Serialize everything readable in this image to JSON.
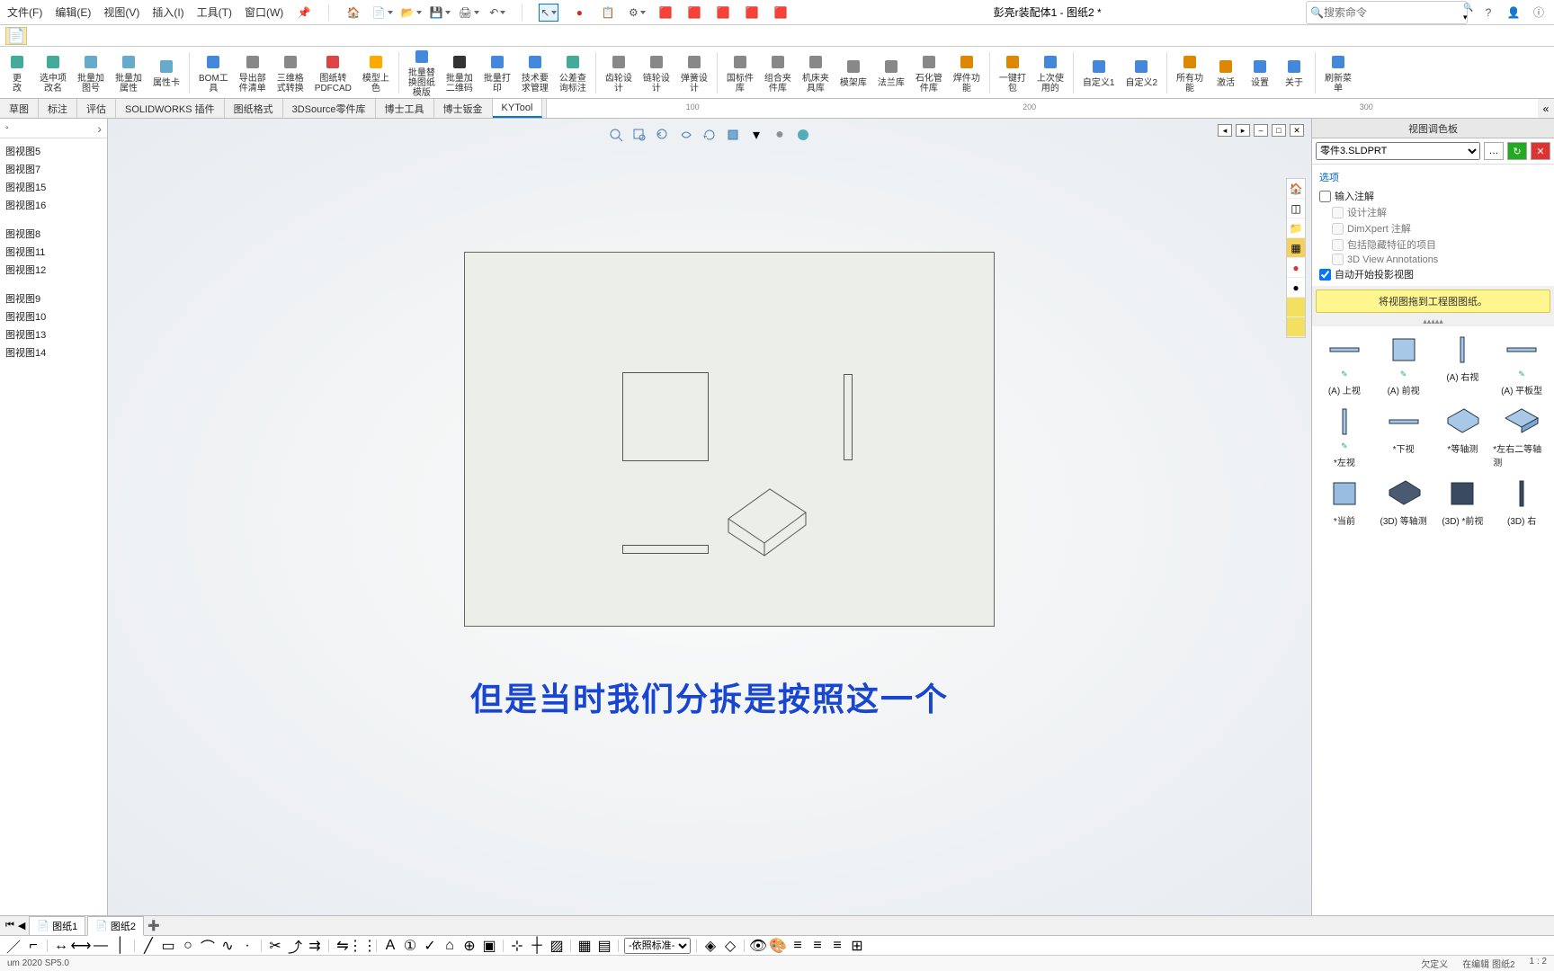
{
  "menubar": {
    "items": [
      {
        "label": "文件(F)"
      },
      {
        "label": "编辑(E)"
      },
      {
        "label": "视图(V)"
      },
      {
        "label": "插入(I)"
      },
      {
        "label": "工具(T)"
      },
      {
        "label": "窗口(W)"
      }
    ],
    "title": "彭亮r装配体1 - 图纸2 *",
    "search_placeholder": "搜索命令"
  },
  "ribbon": [
    {
      "label": "更\n改",
      "icon": "edit"
    },
    {
      "label": "选中项\n改名",
      "icon": "rename"
    },
    {
      "label": "批量加\n图号",
      "icon": "addnum"
    },
    {
      "label": "批量加\n属性",
      "icon": "addprop"
    },
    {
      "label": "属性卡",
      "icon": "card"
    },
    {
      "sep": true
    },
    {
      "label": "BOM工\n具",
      "icon": "bom"
    },
    {
      "label": "导出部\n件清单",
      "icon": "export"
    },
    {
      "label": "三维格\n式转换",
      "icon": "convert"
    },
    {
      "label": "图纸转\nPDFCAD",
      "icon": "pdf"
    },
    {
      "label": "模型上\n色",
      "icon": "color"
    },
    {
      "sep": true
    },
    {
      "label": "批量替\n换图纸\n模版",
      "icon": "replace"
    },
    {
      "label": "批量加\n二维码",
      "icon": "qr"
    },
    {
      "label": "批量打\n印",
      "icon": "print"
    },
    {
      "label": "技术要\n求管理",
      "icon": "tech"
    },
    {
      "label": "公差查\n询标注",
      "icon": "tol"
    },
    {
      "sep": true
    },
    {
      "label": "齿轮设\n计",
      "icon": "gear"
    },
    {
      "label": "链轮设\n计",
      "icon": "sprocket"
    },
    {
      "label": "弹簧设\n计",
      "icon": "spring"
    },
    {
      "sep": true
    },
    {
      "label": "国标件\n库",
      "icon": "gb"
    },
    {
      "label": "组合夹\n件库",
      "icon": "clamp"
    },
    {
      "label": "机床夹\n具库",
      "icon": "fixture"
    },
    {
      "label": "模架库",
      "icon": "mold"
    },
    {
      "label": "法兰库",
      "icon": "flange"
    },
    {
      "label": "石化管\n件库",
      "icon": "pipe"
    },
    {
      "label": "焊件功\n能",
      "icon": "weld"
    },
    {
      "sep": true
    },
    {
      "label": "一键打\n包",
      "icon": "pack"
    },
    {
      "label": "上次使\n用的",
      "icon": "recent"
    },
    {
      "sep": true
    },
    {
      "label": "自定义1",
      "icon": "u1"
    },
    {
      "label": "自定义2",
      "icon": "u2"
    },
    {
      "sep": true
    },
    {
      "label": "所有功\n能",
      "icon": "all"
    },
    {
      "label": "激活",
      "icon": "activate"
    },
    {
      "label": "设置",
      "icon": "setting"
    },
    {
      "label": "关于",
      "icon": "about"
    },
    {
      "sep": true
    },
    {
      "label": "刷新菜\n单",
      "icon": "refresh"
    }
  ],
  "tabs": [
    {
      "label": "草图"
    },
    {
      "label": "标注"
    },
    {
      "label": "评估"
    },
    {
      "label": "SOLIDWORKS 插件"
    },
    {
      "label": "图纸格式"
    },
    {
      "label": "3DSource零件库"
    },
    {
      "label": "博士工具"
    },
    {
      "label": "博士钣金"
    },
    {
      "label": "KYTool",
      "active": true
    }
  ],
  "ruler_ticks": [
    "100",
    "200",
    "300"
  ],
  "tree": {
    "groups": [
      [
        "图视图5",
        "图视图7",
        "图视图15",
        "图视图16"
      ],
      [
        "图视图8",
        "图视图11",
        "图视图12"
      ],
      [
        "图视图9",
        "图视图10",
        "图视图13",
        "图视图14"
      ]
    ]
  },
  "canvas_text": "但是当时我们分拆是按照这一个",
  "right_panel": {
    "title": "视图调色板",
    "file": "零件3.SLDPRT",
    "options_head": "选项",
    "opts": {
      "import_anno": "输入注解",
      "design_anno": "设计注解",
      "dimxpert": "DimXpert 注解",
      "hidden": "包括隐藏特征的项目",
      "view3d": "3D View Annotations",
      "autostart": "自动开始投影视图"
    },
    "yellow_text": "将视图拖到工程图图纸。",
    "views": [
      {
        "label": "(A) 上视",
        "sub": "annot",
        "thumb": "hrect"
      },
      {
        "label": "(A) 前视",
        "sub": "annot",
        "thumb": "square"
      },
      {
        "label": "(A) 右视",
        "sub": "",
        "thumb": "vrect"
      },
      {
        "label": "(A) 平板型",
        "sub": "annot",
        "thumb": "hrect"
      },
      {
        "label": "*左视",
        "sub": "annot",
        "thumb": "vrect"
      },
      {
        "label": "*下视",
        "sub": "",
        "thumb": "hrect"
      },
      {
        "label": "*等轴测",
        "sub": "",
        "thumb": "iso"
      },
      {
        "label": "*左右二等轴\n测",
        "sub": "",
        "thumb": "iso2"
      },
      {
        "label": "*当前",
        "sub": "",
        "thumb": "squarefill"
      },
      {
        "label": "(3D) 等轴测",
        "sub": "",
        "thumb": "iso3d"
      },
      {
        "label": "(3D) *前视",
        "sub": "",
        "thumb": "square3d"
      },
      {
        "label": "(3D) 右",
        "sub": "",
        "thumb": "vrect3d"
      }
    ]
  },
  "sheets": [
    {
      "label": "图纸1"
    },
    {
      "label": "图纸2",
      "active": true
    }
  ],
  "bottom_select": "-依照标准-",
  "status": {
    "left": "um 2020 SP5.0",
    "right1": "欠定义",
    "right2": "在编辑 图纸2",
    "right3": "1 : 2"
  }
}
